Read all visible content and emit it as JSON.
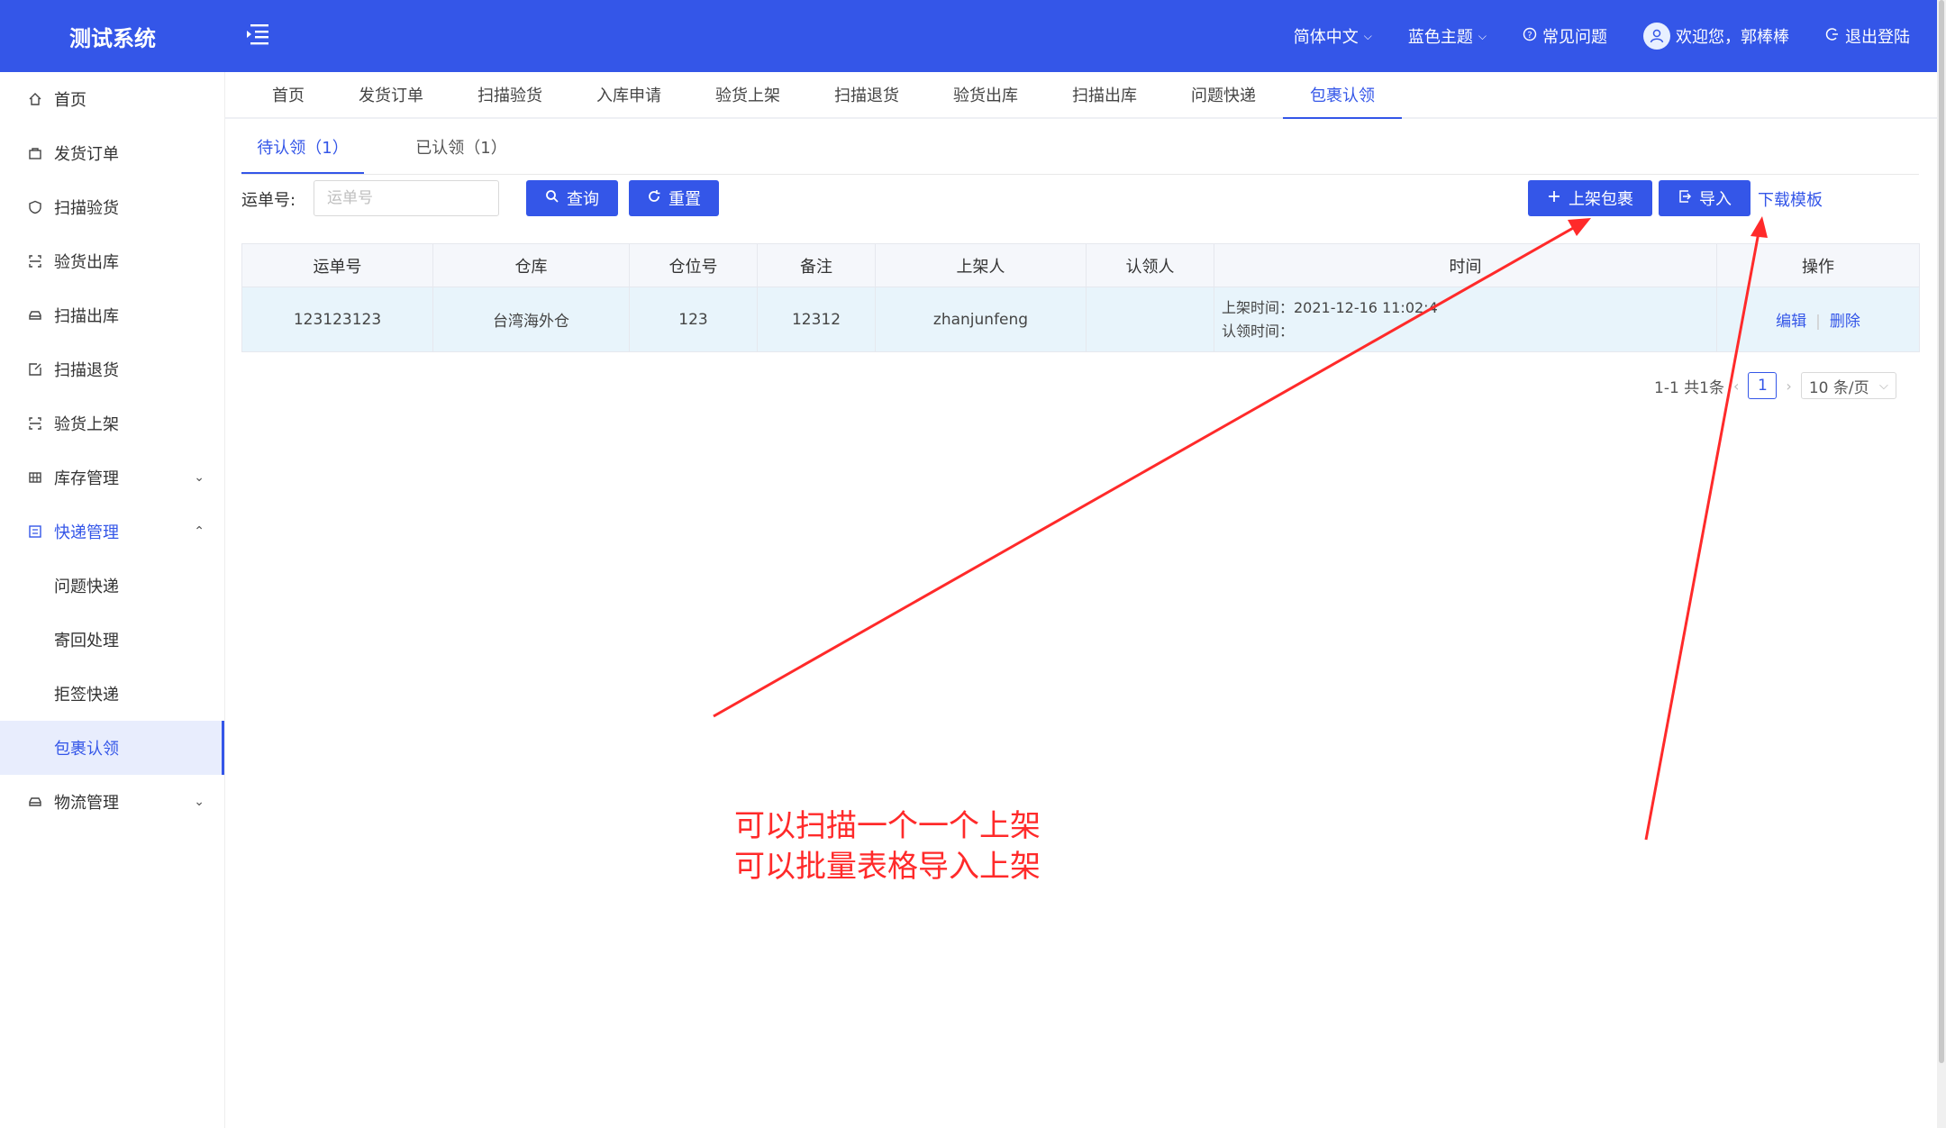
{
  "app": {
    "title": "测试系统"
  },
  "header": {
    "language": "简体中文",
    "theme": "蓝色主题",
    "faq": "常见问题",
    "welcome": "欢迎您，郭棒棒",
    "logout": "退出登陆"
  },
  "sidebar": {
    "items": [
      {
        "label": "首页",
        "icon": "home-icon"
      },
      {
        "label": "发货订单",
        "icon": "bag-icon"
      },
      {
        "label": "扫描验货",
        "icon": "shield-icon"
      },
      {
        "label": "验货出库",
        "icon": "scan-icon"
      },
      {
        "label": "扫描出库",
        "icon": "car-icon"
      },
      {
        "label": "扫描退货",
        "icon": "return-icon"
      },
      {
        "label": "验货上架",
        "icon": "scan-icon"
      },
      {
        "label": "库存管理",
        "icon": "grid-icon"
      },
      {
        "label": "快递管理",
        "icon": "list-icon"
      },
      {
        "label": "问题快递"
      },
      {
        "label": "寄回处理"
      },
      {
        "label": "拒签快递"
      },
      {
        "label": "包裹认领"
      },
      {
        "label": "物流管理",
        "icon": "car-icon"
      }
    ]
  },
  "navtabs": [
    "首页",
    "发货订单",
    "扫描验货",
    "入库申请",
    "验货上架",
    "扫描退货",
    "验货出库",
    "扫描出库",
    "问题快递",
    "包裹认领"
  ],
  "subtabs": [
    "待认领（1）",
    "已认领（1）"
  ],
  "search": {
    "label": "运单号:",
    "placeholder": "运单号",
    "query": "查询",
    "reset": "重置"
  },
  "actions": {
    "shelf": "上架包裹",
    "import": "导入",
    "template": "下载模板"
  },
  "table": {
    "headers": [
      "运单号",
      "仓库",
      "仓位号",
      "备注",
      "上架人",
      "认领人",
      "时间",
      "操作"
    ],
    "rows": [
      {
        "waybill": "123123123",
        "warehouse": "台湾海外仓",
        "slot": "123",
        "remark": "12312",
        "shelver": "zhanjunfeng",
        "claimer": "",
        "shelf_time": "上架时间：2021-12-16 11:02:4",
        "claim_time": "认领时间：",
        "edit": "编辑",
        "delete": "删除"
      }
    ]
  },
  "pagination": {
    "summary": "1-1 共1条",
    "page": "1",
    "size": "10 条/页"
  },
  "annotation": {
    "line1": "可以扫描一个一个上架",
    "line2": "可以批量表格导入上架",
    "color": "#ff2a2a"
  },
  "colors": {
    "primary": "#3456e8",
    "row_highlight": "#e8f4fb"
  }
}
